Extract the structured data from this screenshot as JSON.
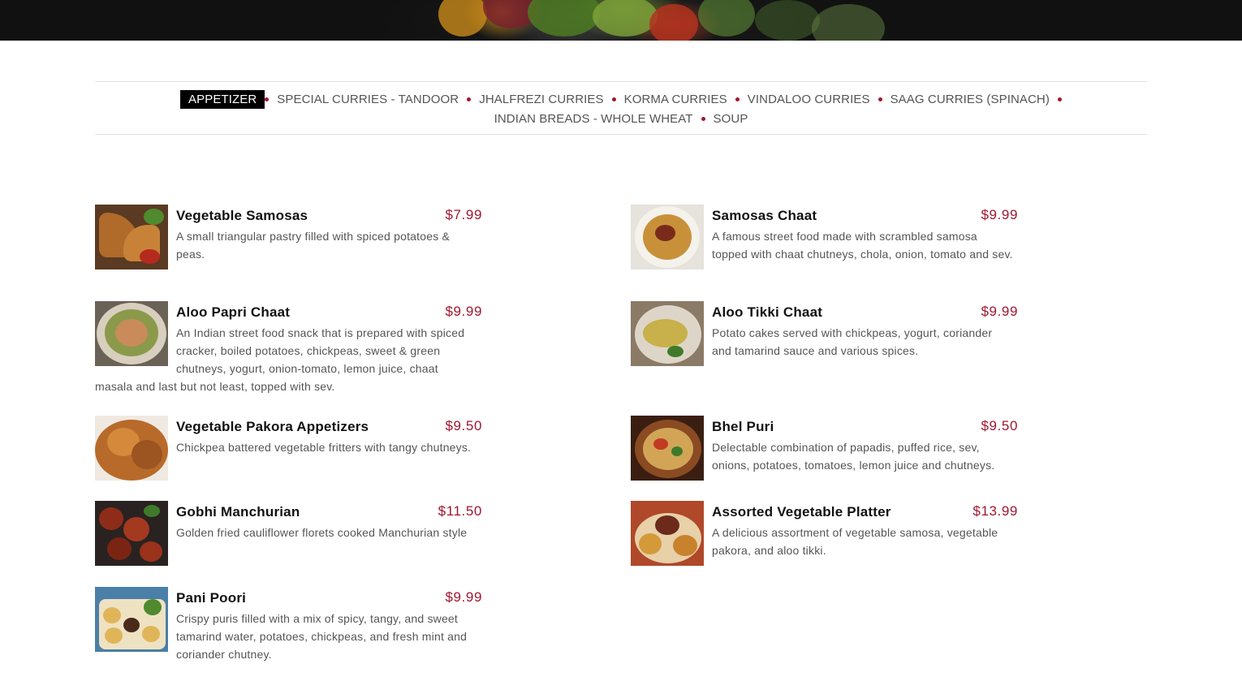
{
  "categories": {
    "row1": [
      {
        "label": "APPETIZER",
        "active": true
      },
      {
        "label": "SPECIAL CURRIES - TANDOOR",
        "active": false
      },
      {
        "label": "JHALFREZI CURRIES",
        "active": false
      },
      {
        "label": "KORMA CURRIES",
        "active": false
      },
      {
        "label": "VINDALOO CURRIES",
        "active": false
      },
      {
        "label": "SAAG CURRIES (SPINACH)",
        "active": false
      }
    ],
    "row2": [
      {
        "label": "INDIAN BREADS - WHOLE WHEAT",
        "active": false
      },
      {
        "label": "SOUP",
        "active": false
      }
    ]
  },
  "menu": {
    "left": [
      {
        "name": "Vegetable Samosas",
        "price": "$7.99",
        "description": "A small triangular pastry filled with spiced potatoes & peas."
      },
      {
        "name": "Aloo Papri Chaat",
        "price": "$9.99",
        "description": "An Indian street food snack that is prepared with spiced cracker, boiled potatoes, chickpeas, sweet & green chutneys, yogurt, onion-tomato, lemon juice, chaat masala and last but not least, topped with sev."
      },
      {
        "name": "Vegetable Pakora Appetizers",
        "price": "$9.50",
        "description": "Chickpea battered vegetable fritters with tangy chutneys."
      },
      {
        "name": "Gobhi Manchurian",
        "price": "$11.50",
        "description": "Golden fried cauliflower florets cooked Manchurian style"
      },
      {
        "name": "Pani Poori",
        "price": "$9.99",
        "description": "Crispy puris filled with a mix of spicy, tangy, and sweet tamarind water, potatoes, chickpeas, and fresh mint and coriander chutney."
      }
    ],
    "right": [
      {
        "name": "Samosas Chaat",
        "price": "$9.99",
        "description": "A famous street food made with scrambled samosa topped with chaat chutneys, chola, onion, tomato and sev."
      },
      {
        "name": "Aloo Tikki Chaat",
        "price": "$9.99",
        "description": "Potato cakes served with chickpeas, yogurt, coriander and tamarind sauce and various spices."
      },
      {
        "name": "Bhel Puri",
        "price": "$9.50",
        "description": "Delectable combination of papadis, puffed rice, sev, onions, potatoes, tomatoes, lemon juice and chutneys."
      },
      {
        "name": "Assorted Vegetable Platter",
        "price": "$13.99",
        "description": "A delicious assortment of vegetable samosa, vegetable pakora, and aloo tikki."
      }
    ]
  },
  "colors": {
    "accent": "#a0162f",
    "active_tab_bg": "#000000",
    "text": "#555555"
  }
}
